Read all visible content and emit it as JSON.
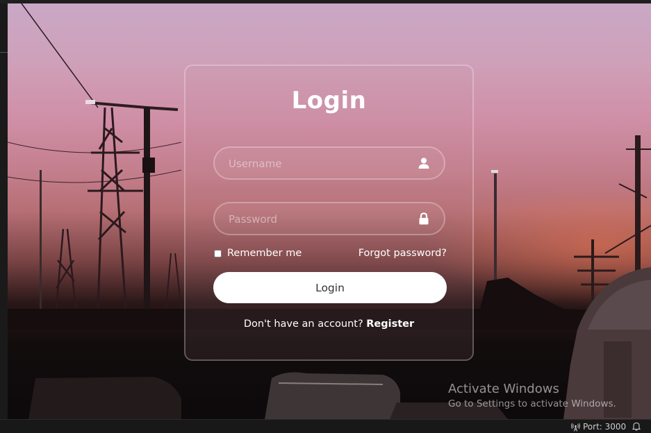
{
  "login": {
    "title": "Login",
    "username_placeholder": "Username",
    "password_placeholder": "Password",
    "remember_label": "Remember me",
    "forgot_label": "Forgot password?",
    "submit_label": "Login",
    "register_prompt": "Don't have an account?",
    "register_link": "Register"
  },
  "watermark": {
    "title": "Activate Windows",
    "subtitle": "Go to Settings to activate Windows."
  },
  "statusbar": {
    "port_label": "Port: 3000"
  },
  "icons": {
    "username": "user-icon",
    "password": "lock-icon",
    "port": "broadcast-icon",
    "notifications": "bell-icon"
  },
  "colors": {
    "card_border": "#ffffff",
    "button_bg": "#ffffff",
    "button_text": "#333333"
  }
}
